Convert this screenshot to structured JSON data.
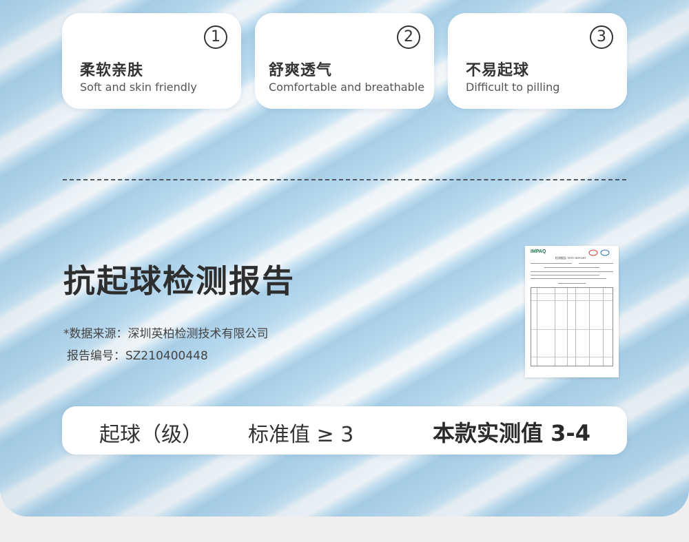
{
  "features": [
    {
      "num": "1",
      "cn": "柔软亲肤",
      "en": "Soft and skin friendly"
    },
    {
      "num": "2",
      "cn": "舒爽透气",
      "en": "Comfortable and breathable"
    },
    {
      "num": "3",
      "cn": "不易起球",
      "en": "Difficult to pilling"
    }
  ],
  "report": {
    "title": "抗起球检测报告",
    "source": "*数据来源：深圳英柏检测技术有限公司",
    "number": "报告编号：SZ210400448",
    "doc_logo": "IMPAQ",
    "doc_title": "检测报告 TEST REPORT"
  },
  "summary": {
    "label": "起球（级）",
    "standard": "标准值 ≥ 3",
    "measured": "本款实测值 3-4"
  },
  "colors": {
    "stripe_blue": "#a9cfe8",
    "stripe_white": "#f4f7f9",
    "card_bg": "#ffffff",
    "text_dark": "#333333"
  }
}
